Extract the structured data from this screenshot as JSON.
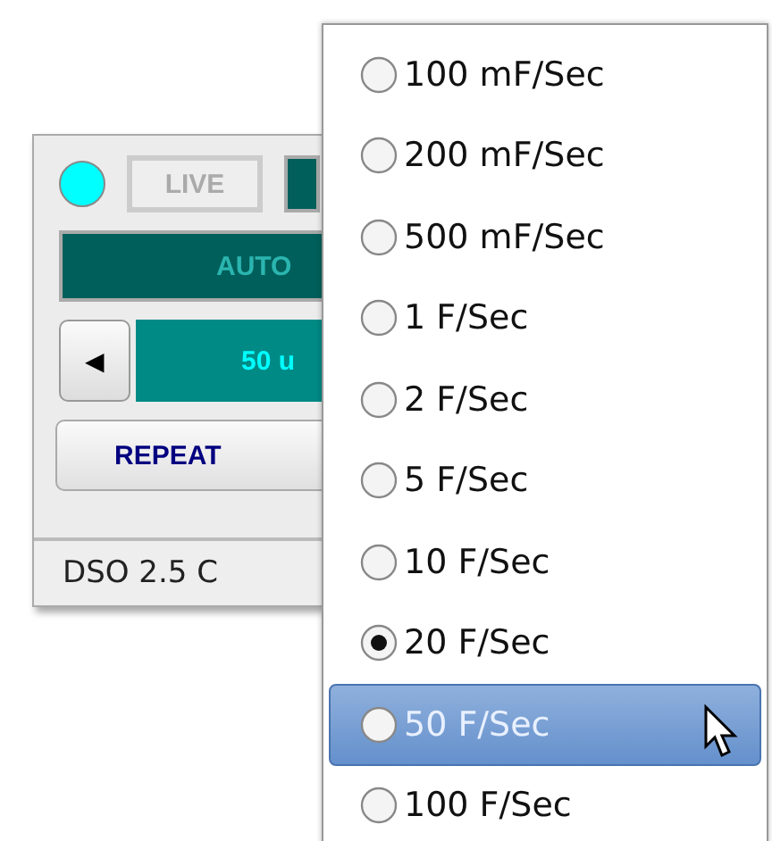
{
  "window": {
    "indicator": {
      "color": "#00ffff"
    },
    "live_button": {
      "label": "LIVE",
      "disabled": true
    },
    "mode_bar": {
      "label": "AUTO"
    },
    "timebase": {
      "left_button": "◀",
      "value": "50 u"
    },
    "repeat_button": {
      "label": "REPEAT"
    },
    "status_bar": "DSO 2.5 C"
  },
  "menu": {
    "items": [
      {
        "label": "100 mF/Sec",
        "checked": false,
        "hovered": false
      },
      {
        "label": "200 mF/Sec",
        "checked": false,
        "hovered": false
      },
      {
        "label": "500 mF/Sec",
        "checked": false,
        "hovered": false
      },
      {
        "label": "1 F/Sec",
        "checked": false,
        "hovered": false
      },
      {
        "label": "2 F/Sec",
        "checked": false,
        "hovered": false
      },
      {
        "label": "5 F/Sec",
        "checked": false,
        "hovered": false
      },
      {
        "label": "10 F/Sec",
        "checked": false,
        "hovered": false
      },
      {
        "label": "20 F/Sec",
        "checked": true,
        "hovered": false
      },
      {
        "label": "50 F/Sec",
        "checked": false,
        "hovered": true
      },
      {
        "label": "100 F/Sec",
        "checked": false,
        "hovered": false
      }
    ]
  }
}
